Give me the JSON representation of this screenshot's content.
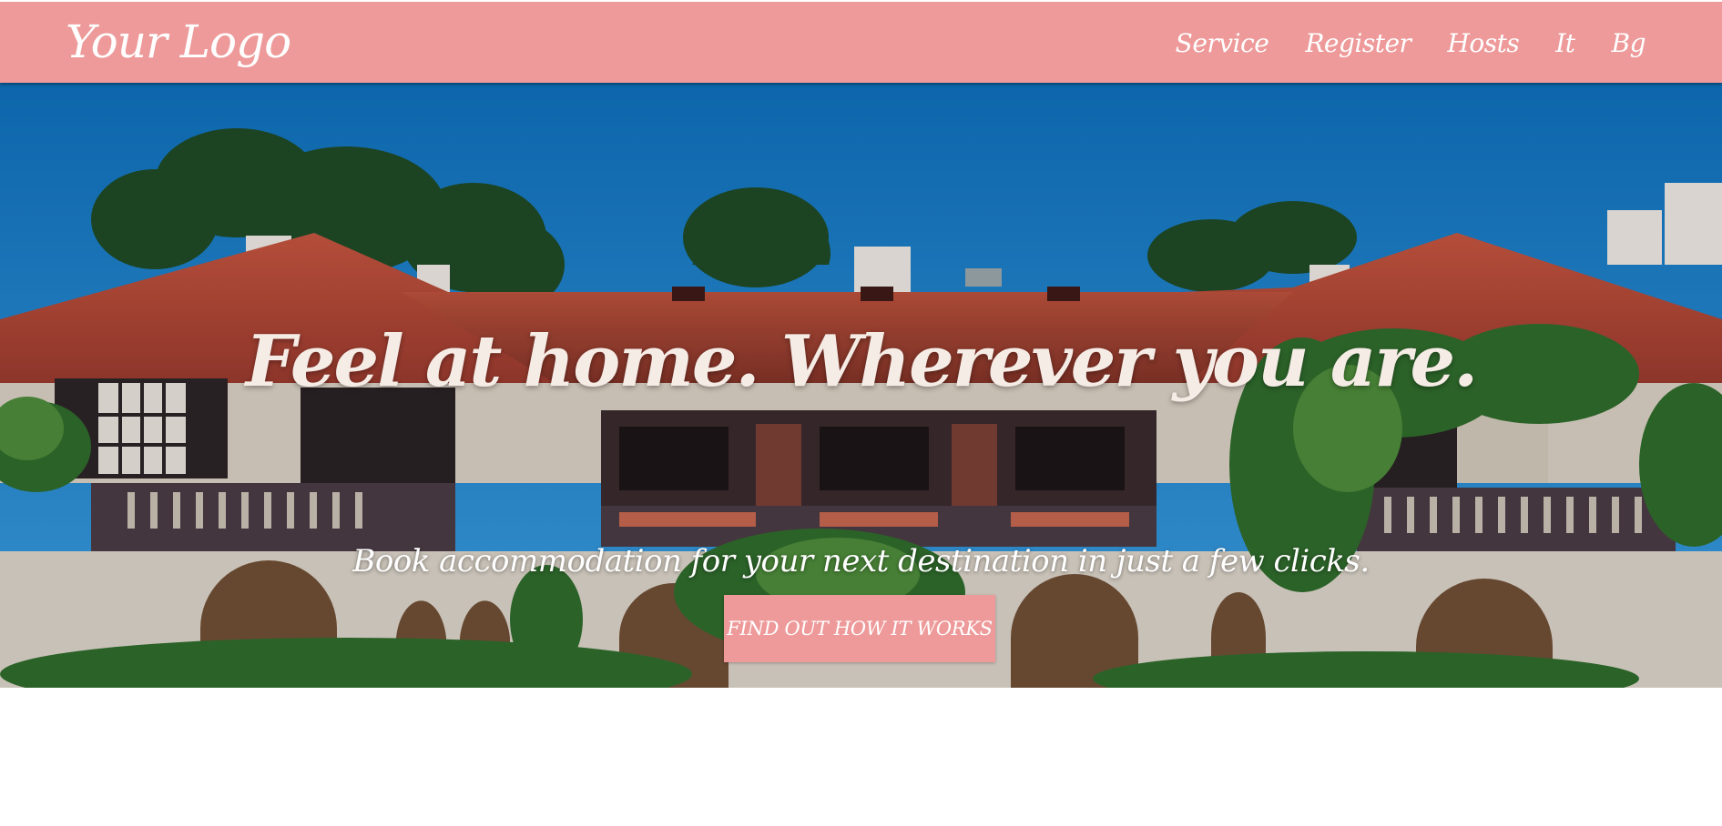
{
  "header": {
    "logo": "Your Logo",
    "nav": [
      {
        "label": "Service"
      },
      {
        "label": "Register"
      },
      {
        "label": "Hosts"
      },
      {
        "label": "It"
      },
      {
        "label": "Bg"
      }
    ],
    "background_color": "#ee9a9a"
  },
  "hero": {
    "title": "Feel at home. Wherever you are.",
    "subtitle": "Book accommodation for your next destination in just a few clicks.",
    "cta_label": "FIND OUT HOW IT WORKS",
    "background_image": "villa-with-terracotta-roof-photo"
  },
  "colors": {
    "accent": "#ee9a9a",
    "sky": "#1b7bc4",
    "roof": "#b5483a",
    "text_light": "#ffffff"
  }
}
